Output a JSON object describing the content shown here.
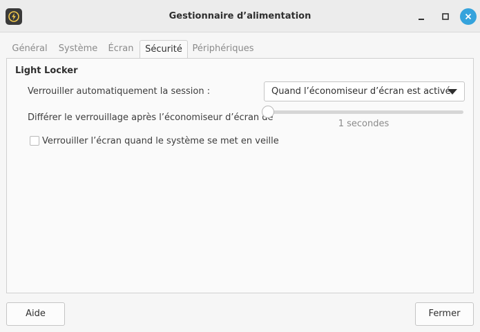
{
  "window": {
    "title": "Gestionnaire d’alimentation",
    "icon": "power-manager-icon"
  },
  "tabs": [
    {
      "label": "Général",
      "active": false
    },
    {
      "label": "Système",
      "active": false
    },
    {
      "label": "Écran",
      "active": false
    },
    {
      "label": "Sécurité",
      "active": true
    },
    {
      "label": "Périphériques",
      "active": false
    }
  ],
  "security": {
    "section_title": "Light Locker",
    "auto_lock_label": "Verrouiller automatiquement la session :",
    "auto_lock_value": "Quand l’économiseur d’écran est activé",
    "delay_label": "Différer le verrouillage après l’économiseur d’écran de",
    "delay_value_text": "1 secondes",
    "delay_value": 1,
    "lock_on_sleep_label": "Verrouiller l’écran quand le système se met en veille",
    "lock_on_sleep_checked": false
  },
  "footer": {
    "help_label": "Aide",
    "close_label": "Fermer"
  },
  "colors": {
    "accent": "#35a3dc",
    "window_bg": "#f6f6f6"
  }
}
